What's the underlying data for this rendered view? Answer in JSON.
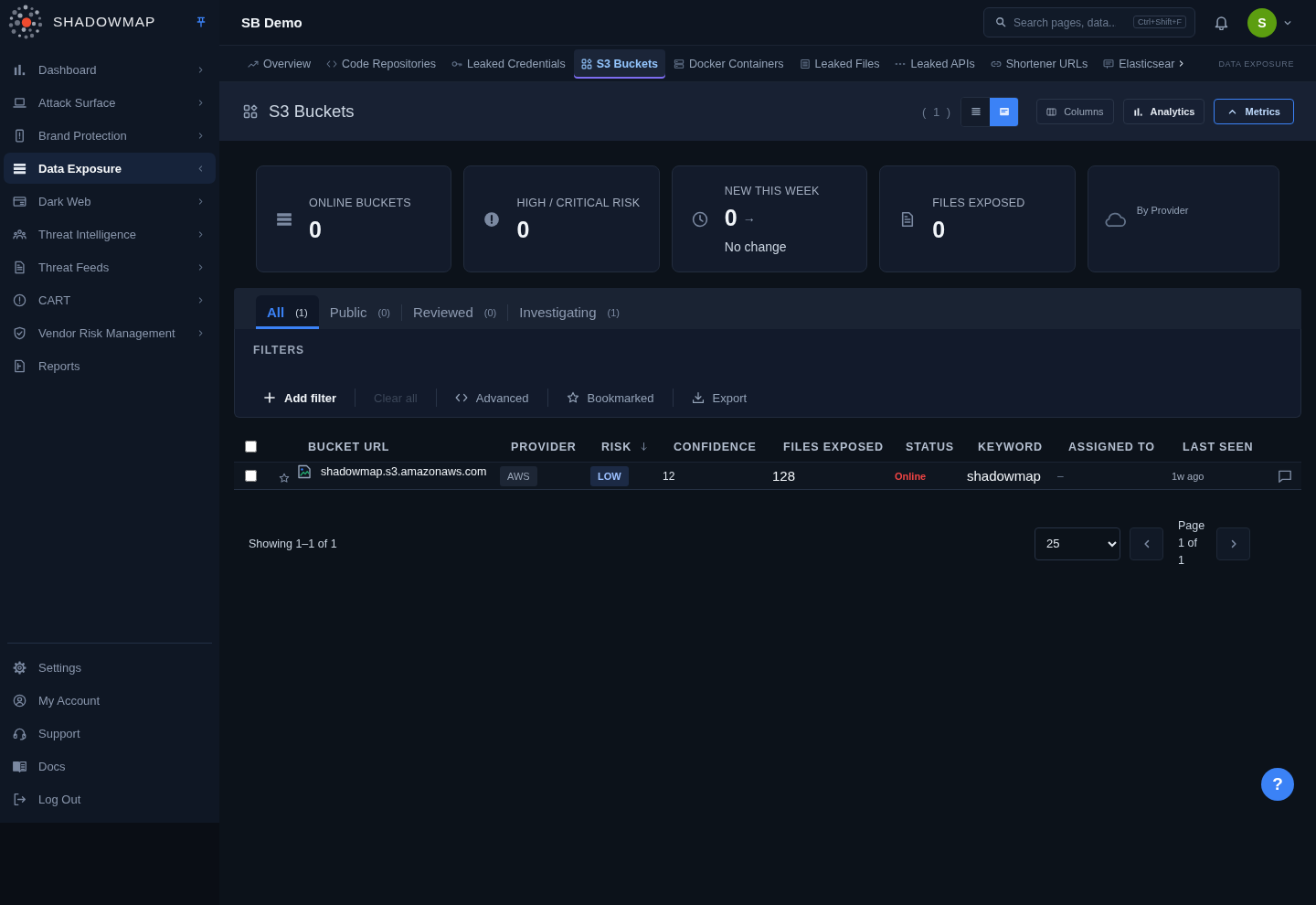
{
  "sidebar": {
    "brand": "SHADOWMAP",
    "nav_items": [
      {
        "label": "Dashboard",
        "kind": "group",
        "selected": false,
        "expanded": false
      },
      {
        "label": "Attack Surface",
        "kind": "group",
        "selected": false,
        "expanded": false
      },
      {
        "label": "Brand Protection",
        "kind": "group",
        "selected": false,
        "expanded": false
      },
      {
        "label": "Data Exposure",
        "kind": "group",
        "selected": true,
        "expanded": true
      },
      {
        "label": "Dark Web",
        "kind": "group",
        "selected": false,
        "expanded": false
      },
      {
        "label": "Threat Intelligence",
        "kind": "group",
        "selected": false,
        "expanded": false
      },
      {
        "label": "Threat Feeds",
        "kind": "group",
        "selected": false,
        "expanded": false
      },
      {
        "label": "CART",
        "kind": "group",
        "selected": false,
        "expanded": false
      },
      {
        "label": "Vendor Risk Management",
        "kind": "group",
        "selected": false,
        "expanded": false
      },
      {
        "label": "Reports",
        "kind": "link",
        "selected": false
      }
    ],
    "footer_items": [
      {
        "label": "Settings"
      },
      {
        "label": "My Account"
      },
      {
        "label": "Support"
      },
      {
        "label": "Docs"
      },
      {
        "label": "Log Out"
      }
    ]
  },
  "header": {
    "title": "SB Demo",
    "search": {
      "placeholder": "Search pages, data...",
      "shortcut": "Ctrl+Shift+F"
    },
    "avatar": "S"
  },
  "section_nav": {
    "tabs": [
      {
        "label": "Overview",
        "selected": false
      },
      {
        "label": "Code Repositories",
        "selected": false
      },
      {
        "label": "Leaked Credentials",
        "selected": false
      },
      {
        "label": "S3 Buckets",
        "selected": true
      },
      {
        "label": "Docker Containers",
        "selected": false
      },
      {
        "label": "Leaked Files",
        "selected": false
      },
      {
        "label": "Leaked APIs",
        "selected": false
      },
      {
        "label": "Shortener URLs",
        "selected": false
      },
      {
        "label": "Elasticsear",
        "selected": false
      }
    ],
    "section_label": "DATA EXPOSURE"
  },
  "page": {
    "title": "S3 Buckets",
    "count": "( 1 )",
    "view_modes": [
      {
        "kind": "list",
        "selected": false
      },
      {
        "kind": "cards",
        "selected": true
      }
    ],
    "buttons": [
      {
        "kind": "columns",
        "label": "Columns",
        "active": false
      },
      {
        "kind": "analytics",
        "label": "Analytics",
        "active": false
      },
      {
        "kind": "metrics",
        "label": "Metrics",
        "active": true
      }
    ]
  },
  "stat_cards": [
    {
      "kind": "stat",
      "label": "ONLINE BUCKETS",
      "value": "0"
    },
    {
      "kind": "stat",
      "label": "HIGH / CRITICAL RISK",
      "value": "0"
    },
    {
      "kind": "trend",
      "label": "NEW THIS WEEK",
      "value": "0",
      "trend": "→",
      "note": "No change"
    },
    {
      "kind": "stat",
      "label": "FILES EXPOSED",
      "value": "0"
    },
    {
      "kind": "breakdown",
      "label": "By Provider"
    }
  ],
  "status_tabs": [
    {
      "label": "All",
      "count": "(1)",
      "selected": true
    },
    {
      "label": "Public",
      "count": "(0)",
      "selected": false
    },
    {
      "label": "Reviewed",
      "count": "(0)",
      "selected": false
    },
    {
      "label": "Investigating",
      "count": "(1)",
      "selected": false
    }
  ],
  "filters": {
    "title": "FILTERS",
    "actions": [
      {
        "kind": "add",
        "label": "Add filter",
        "disabled": false
      },
      {
        "kind": "clear",
        "label": "Clear all",
        "disabled": true
      },
      {
        "kind": "advanced",
        "label": "Advanced",
        "disabled": false
      },
      {
        "kind": "bookmarked",
        "label": "Bookmarked",
        "disabled": false
      },
      {
        "kind": "export",
        "label": "Export",
        "disabled": false
      }
    ]
  },
  "table": {
    "select_all": {
      "checked": false
    },
    "columns": [
      {
        "label": "BUCKET URL",
        "sorted": false
      },
      {
        "label": "PROVIDER",
        "sorted": false
      },
      {
        "label": "RISK",
        "sorted": true
      },
      {
        "label": "CONFIDENCE",
        "sorted": false
      },
      {
        "label": "FILES EXPOSED",
        "sorted": false
      },
      {
        "label": "STATUS",
        "sorted": false
      },
      {
        "label": "KEYWORD",
        "sorted": false
      },
      {
        "label": "ASSIGNED TO",
        "sorted": false
      },
      {
        "label": "LAST SEEN",
        "sorted": false
      }
    ],
    "rows": [
      {
        "checked": false,
        "bookmarked": false,
        "bucket_url": "shadowmap.s3.amazonaws.com",
        "provider": "AWS",
        "risk": "LOW",
        "confidence": "12",
        "files_exposed": "128",
        "status": "Online",
        "keyword": "shadowmap",
        "assigned_to": "–",
        "last_seen": "1w ago"
      }
    ]
  },
  "pagination": {
    "summary": "Showing 1–1 of 1",
    "page_size": "25",
    "page": "Page 1 of 1"
  },
  "help": {
    "label": "?"
  }
}
